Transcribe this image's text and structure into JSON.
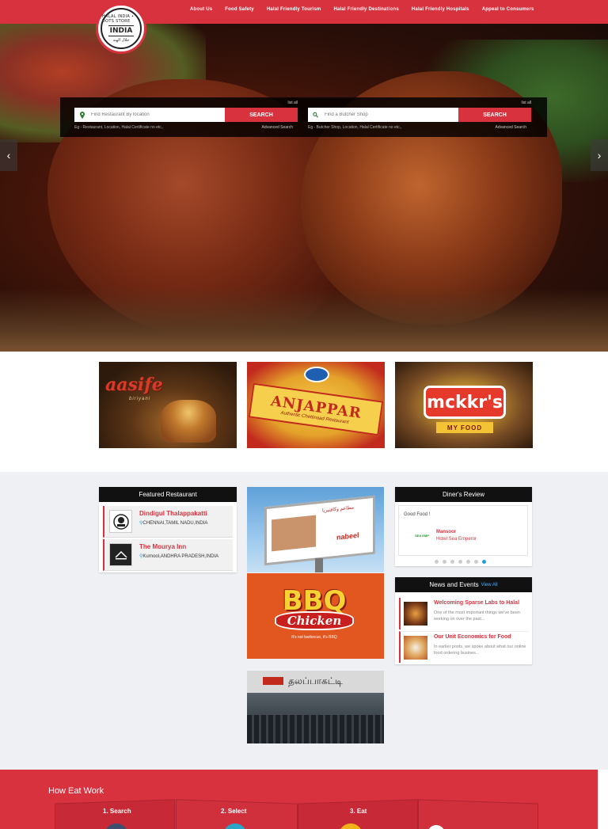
{
  "header": {
    "logo": {
      "top": "HALAL INDIA • DOTS STORE",
      "middle": "INDIA",
      "bottom": "حلال الهند"
    },
    "nav": [
      "About Us",
      "Food Safety",
      "Halal Friendly Tourism",
      "Halal Friendly Destinations",
      "Halal Friendly Hospitals",
      "Appeal to Consumers"
    ]
  },
  "search": {
    "restaurant": {
      "list_all": "list all",
      "placeholder": "Find Restaurant By location",
      "button": "SEARCH",
      "hint": "Eg - Restaurant, Location, Halal Certificate no etc.,",
      "advanced": "Advanced Search"
    },
    "butcher": {
      "list_all": "list all",
      "placeholder": "Find a Butcher Shop",
      "button": "SEARCH",
      "hint": "Eg - Butcher Shop, Location, Halal Certificate no etc.,",
      "advanced": "Advanced Search"
    }
  },
  "carousel": {
    "prev": "‹",
    "next": "›"
  },
  "brands": [
    {
      "name": "aasife",
      "sub": "biriyani"
    },
    {
      "name": "ANJAPPAR",
      "sub": "Authentic Chettinaad Restaurant"
    },
    {
      "name": "mckkr's",
      "sub": "MY FOOD"
    }
  ],
  "featured": {
    "title": "Featured Restaurant",
    "items": [
      {
        "name": "Dindigul Thalappakatti",
        "location": "CHENNAI,TAMIL NADU,INDIA"
      },
      {
        "name": "The Mourya Inn",
        "location": "Kurnool,ANDHRA PRADESH,INDIA"
      }
    ]
  },
  "ads": {
    "nabeel": {
      "text": "nabeel",
      "arabic": "مطاعم وكافتيريا"
    },
    "bbq": {
      "top": "BBQ",
      "bottom": "Chicken",
      "tagline": "It's not barbecue, it's BBQ"
    },
    "shop": {
      "sign": "தலப்பாகட்டி"
    }
  },
  "diners": {
    "title": "Diner's Review",
    "quote": "Good Food !",
    "reviewer": "Mansoor",
    "hotel": "Hotel Sea Emperor",
    "avatar_text": "SEA EMP",
    "slides": 7,
    "active_slide": 7
  },
  "news": {
    "title": "News and Events",
    "view_all": "View All",
    "items": [
      {
        "title": "Welcoming Sparse Labs to Halal",
        "desc": "One of the most important things we've been working on over the past..."
      },
      {
        "title": "Our Unit Economics for Food",
        "desc": "In earlier posts, we spoke about what our online food ordering busines..."
      }
    ]
  },
  "how": {
    "title": "How Eat Work",
    "steps": [
      "1. Search",
      "2. Select",
      "3. Eat",
      ""
    ]
  },
  "colors": {
    "brand": "#d9323f",
    "dark": "#111111",
    "grey": "#eef0f3",
    "accent_blue": "#1aa0e0"
  }
}
